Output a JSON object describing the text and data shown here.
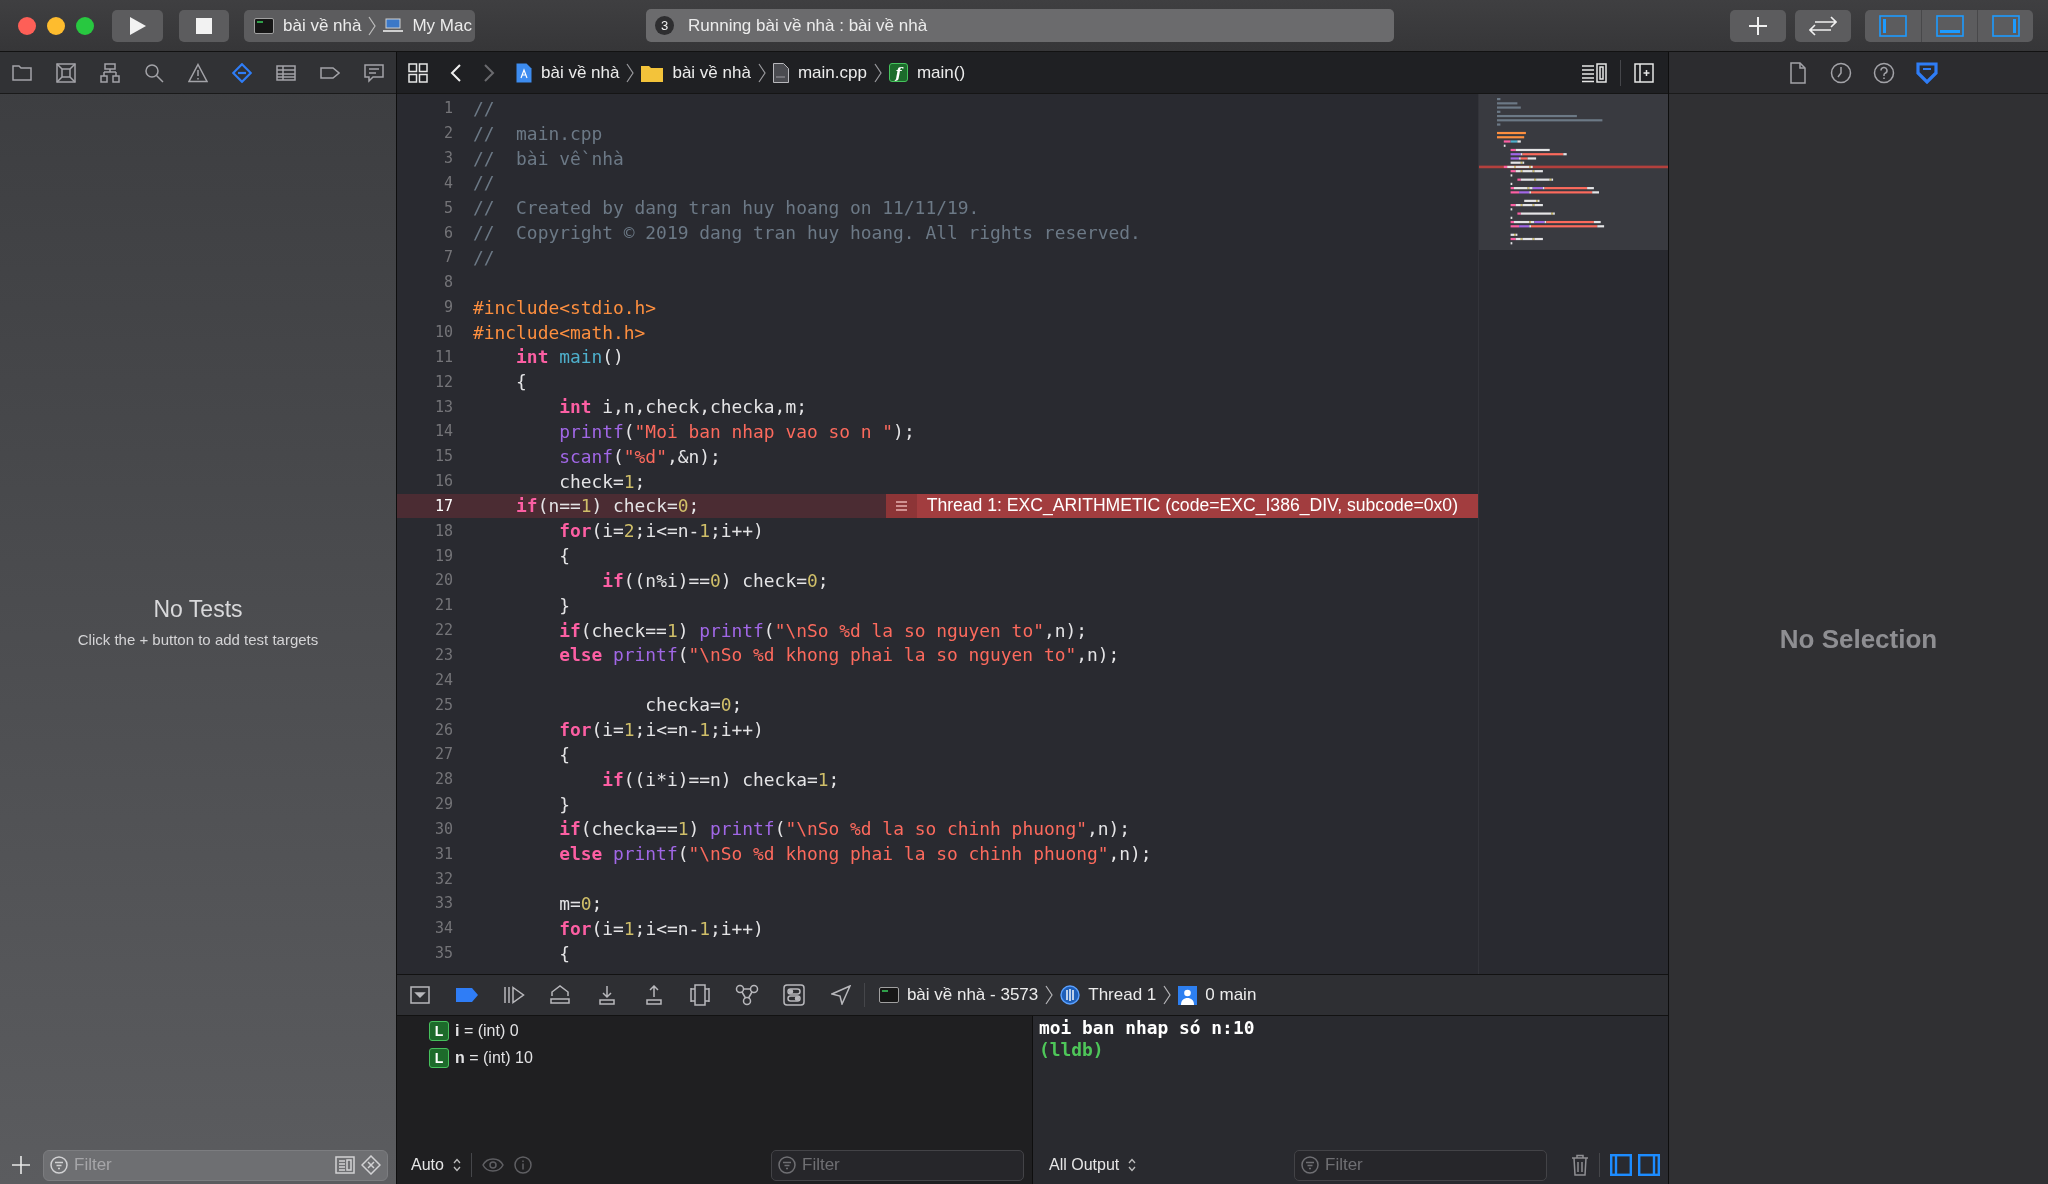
{
  "toolbar": {
    "scheme": {
      "target": "bài về nhà",
      "destination": "My Mac"
    },
    "activity": {
      "badge": "3",
      "status": "Running bài về nhà : bài về nhà"
    },
    "panel_toggles": [
      {
        "on": true
      },
      {
        "on": true
      },
      {
        "on": true
      }
    ]
  },
  "navigator": {
    "tabs": [
      {
        "selected": false
      },
      {
        "selected": false
      },
      {
        "selected": false
      },
      {
        "selected": false
      },
      {
        "selected": false
      },
      {
        "selected": true
      },
      {
        "selected": false
      },
      {
        "selected": false
      },
      {
        "selected": false
      }
    ],
    "empty_title": "No Tests",
    "empty_hint": "Click the + button to add test targets",
    "filter": {
      "placeholder": "Filter"
    }
  },
  "jump_bar": {
    "back_enabled": true,
    "forward_enabled": false,
    "path": [
      {
        "kind": "project",
        "label": "bài về nhà"
      },
      {
        "kind": "folder",
        "label": "bài về nhà"
      },
      {
        "kind": "file",
        "label": "main.cpp"
      },
      {
        "kind": "function",
        "badge": "f",
        "label": "main()"
      }
    ]
  },
  "editor": {
    "lines": [
      {
        "number": "1",
        "highlighted": false,
        "tokens": [
          {
            "kind": "comment",
            "text": "//"
          }
        ]
      },
      {
        "number": "2",
        "highlighted": false,
        "tokens": [
          {
            "kind": "comment",
            "text": "//  main.cpp"
          }
        ]
      },
      {
        "number": "3",
        "highlighted": false,
        "tokens": [
          {
            "kind": "comment",
            "text": "//  bài về nhà"
          }
        ]
      },
      {
        "number": "4",
        "highlighted": false,
        "tokens": [
          {
            "kind": "comment",
            "text": "//"
          }
        ]
      },
      {
        "number": "5",
        "highlighted": false,
        "tokens": [
          {
            "kind": "comment",
            "text": "//  Created by dang tran huy hoang on 11/11/19."
          }
        ]
      },
      {
        "number": "6",
        "highlighted": false,
        "tokens": [
          {
            "kind": "comment",
            "text": "//  Copyright © 2019 dang tran huy hoang. All rights reserved."
          }
        ]
      },
      {
        "number": "7",
        "highlighted": false,
        "tokens": [
          {
            "kind": "comment",
            "text": "//"
          }
        ]
      },
      {
        "number": "8",
        "highlighted": false
      },
      {
        "number": "9",
        "highlighted": false,
        "tokens": [
          {
            "kind": "preprocessor",
            "text": "#include<stdio.h>"
          }
        ]
      },
      {
        "number": "10",
        "highlighted": false,
        "tokens": [
          {
            "kind": "preprocessor",
            "text": "#include<math.h>"
          }
        ]
      },
      {
        "number": "11",
        "highlighted": false,
        "tokens": [
          {
            "kind": "keyword",
            "text": "    int "
          },
          {
            "kind": "declaration",
            "text": "main"
          },
          {
            "kind": "plain",
            "text": "()"
          }
        ]
      },
      {
        "number": "12",
        "highlighted": false,
        "tokens": [
          {
            "kind": "plain",
            "text": "    {"
          }
        ]
      },
      {
        "number": "13",
        "highlighted": false,
        "tokens": [
          {
            "kind": "keyword",
            "text": "        int"
          },
          {
            "kind": "plain",
            "text": " i,n,check,checka,m;"
          }
        ]
      },
      {
        "number": "14",
        "highlighted": false,
        "tokens": [
          {
            "kind": "function",
            "text": "        printf"
          },
          {
            "kind": "plain",
            "text": "("
          },
          {
            "kind": "string",
            "text": "\"Moi ban nhap vao so n \""
          },
          {
            "kind": "plain",
            "text": ");"
          }
        ]
      },
      {
        "number": "15",
        "highlighted": false,
        "tokens": [
          {
            "kind": "function",
            "text": "        scanf"
          },
          {
            "kind": "plain",
            "text": "("
          },
          {
            "kind": "string",
            "text": "\"%d\""
          },
          {
            "kind": "plain",
            "text": ",&n);"
          }
        ]
      },
      {
        "number": "16",
        "highlighted": false,
        "tokens": [
          {
            "kind": "plain",
            "text": "        check="
          },
          {
            "kind": "number",
            "text": "1"
          },
          {
            "kind": "plain",
            "text": ";"
          }
        ]
      },
      {
        "number": "17",
        "highlighted": true,
        "tokens": [
          {
            "kind": "keyword",
            "text": "    if"
          },
          {
            "kind": "plain",
            "text": "(n=="
          },
          {
            "kind": "number",
            "text": "1"
          },
          {
            "kind": "plain",
            "text": ") check="
          },
          {
            "kind": "number",
            "text": "0"
          },
          {
            "kind": "plain",
            "text": ";"
          }
        ],
        "annotation": "Thread 1: EXC_ARITHMETIC (code=EXC_I386_DIV, subcode=0x0)"
      },
      {
        "number": "18",
        "highlighted": false,
        "tokens": [
          {
            "kind": "keyword",
            "text": "        for"
          },
          {
            "kind": "plain",
            "text": "(i="
          },
          {
            "kind": "number",
            "text": "2"
          },
          {
            "kind": "plain",
            "text": ";i<=n-"
          },
          {
            "kind": "number",
            "text": "1"
          },
          {
            "kind": "plain",
            "text": ";i++)"
          }
        ]
      },
      {
        "number": "19",
        "highlighted": false,
        "tokens": [
          {
            "kind": "plain",
            "text": "        {"
          }
        ]
      },
      {
        "number": "20",
        "highlighted": false,
        "tokens": [
          {
            "kind": "keyword",
            "text": "            if"
          },
          {
            "kind": "plain",
            "text": "((n%i)=="
          },
          {
            "kind": "number",
            "text": "0"
          },
          {
            "kind": "plain",
            "text": ") check="
          },
          {
            "kind": "number",
            "text": "0"
          },
          {
            "kind": "plain",
            "text": ";"
          }
        ]
      },
      {
        "number": "21",
        "highlighted": false,
        "tokens": [
          {
            "kind": "plain",
            "text": "        }"
          }
        ]
      },
      {
        "number": "22",
        "highlighted": false,
        "tokens": [
          {
            "kind": "keyword",
            "text": "        if"
          },
          {
            "kind": "plain",
            "text": "(check=="
          },
          {
            "kind": "number",
            "text": "1"
          },
          {
            "kind": "plain",
            "text": ") "
          },
          {
            "kind": "function",
            "text": "printf"
          },
          {
            "kind": "plain",
            "text": "("
          },
          {
            "kind": "string",
            "text": "\"\\nSo %d la so nguyen to\""
          },
          {
            "kind": "plain",
            "text": ",n);"
          }
        ]
      },
      {
        "number": "23",
        "highlighted": false,
        "tokens": [
          {
            "kind": "keyword",
            "text": "        else "
          },
          {
            "kind": "function",
            "text": "printf"
          },
          {
            "kind": "plain",
            "text": "("
          },
          {
            "kind": "string",
            "text": "\"\\nSo %d khong phai la so nguyen to\""
          },
          {
            "kind": "plain",
            "text": ",n);"
          }
        ]
      },
      {
        "number": "24",
        "highlighted": false
      },
      {
        "number": "25",
        "highlighted": false,
        "tokens": [
          {
            "kind": "plain",
            "text": "                checka="
          },
          {
            "kind": "number",
            "text": "0"
          },
          {
            "kind": "plain",
            "text": ";"
          }
        ]
      },
      {
        "number": "26",
        "highlighted": false,
        "tokens": [
          {
            "kind": "keyword",
            "text": "        for"
          },
          {
            "kind": "plain",
            "text": "(i="
          },
          {
            "kind": "number",
            "text": "1"
          },
          {
            "kind": "plain",
            "text": ";i<=n-"
          },
          {
            "kind": "number",
            "text": "1"
          },
          {
            "kind": "plain",
            "text": ";i++)"
          }
        ]
      },
      {
        "number": "27",
        "highlighted": false,
        "tokens": [
          {
            "kind": "plain",
            "text": "        {"
          }
        ]
      },
      {
        "number": "28",
        "highlighted": false,
        "tokens": [
          {
            "kind": "keyword",
            "text": "            if"
          },
          {
            "kind": "plain",
            "text": "((i*i)==n) checka="
          },
          {
            "kind": "number",
            "text": "1"
          },
          {
            "kind": "plain",
            "text": ";"
          }
        ]
      },
      {
        "number": "29",
        "highlighted": false,
        "tokens": [
          {
            "kind": "plain",
            "text": "        }"
          }
        ]
      },
      {
        "number": "30",
        "highlighted": false,
        "tokens": [
          {
            "kind": "keyword",
            "text": "        if"
          },
          {
            "kind": "plain",
            "text": "(checka=="
          },
          {
            "kind": "number",
            "text": "1"
          },
          {
            "kind": "plain",
            "text": ") "
          },
          {
            "kind": "function",
            "text": "printf"
          },
          {
            "kind": "plain",
            "text": "("
          },
          {
            "kind": "string",
            "text": "\"\\nSo %d la so chinh phuong\""
          },
          {
            "kind": "plain",
            "text": ",n);"
          }
        ]
      },
      {
        "number": "31",
        "highlighted": false,
        "tokens": [
          {
            "kind": "keyword",
            "text": "        else "
          },
          {
            "kind": "function",
            "text": "printf"
          },
          {
            "kind": "plain",
            "text": "("
          },
          {
            "kind": "string",
            "text": "\"\\nSo %d khong phai la so chinh phuong\""
          },
          {
            "kind": "plain",
            "text": ",n);"
          }
        ]
      },
      {
        "number": "32",
        "highlighted": false
      },
      {
        "number": "33",
        "highlighted": false,
        "tokens": [
          {
            "kind": "plain",
            "text": "        m="
          },
          {
            "kind": "number",
            "text": "0"
          },
          {
            "kind": "plain",
            "text": ";"
          }
        ]
      },
      {
        "number": "34",
        "highlighted": false,
        "tokens": [
          {
            "kind": "keyword",
            "text": "        for"
          },
          {
            "kind": "plain",
            "text": "(i="
          },
          {
            "kind": "number",
            "text": "1"
          },
          {
            "kind": "plain",
            "text": ";i<=n-"
          },
          {
            "kind": "number",
            "text": "1"
          },
          {
            "kind": "plain",
            "text": ";i++)"
          }
        ]
      },
      {
        "number": "35",
        "highlighted": false,
        "tokens": [
          {
            "kind": "plain",
            "text": "        {"
          }
        ]
      }
    ]
  },
  "debug_bar": {
    "breakpoints_active": true,
    "process": "bài về nhà - 3573",
    "thread": "Thread 1",
    "frame": "0 main"
  },
  "variables": {
    "rows": [
      {
        "badge": "L",
        "text": "**i** = (int) 0"
      },
      {
        "badge": "L",
        "text": "**n** = (int) 10"
      }
    ],
    "scope": "Auto",
    "filter": {
      "placeholder": "Filter"
    }
  },
  "console": {
    "lines": [
      {
        "kind": "output",
        "text": "moi ban nhap só n:10"
      },
      {
        "kind": "prompt",
        "text": "(lldb)"
      }
    ],
    "output_mode": "All Output",
    "filter": {
      "placeholder": "Filter"
    },
    "panel_toggles": [
      {
        "on": true
      },
      {
        "on": true
      }
    ]
  },
  "inspector": {
    "tabs": [
      {
        "selected": false
      },
      {
        "selected": false
      },
      {
        "selected": false
      },
      {
        "selected": true
      }
    ],
    "empty_title": "No Selection"
  }
}
